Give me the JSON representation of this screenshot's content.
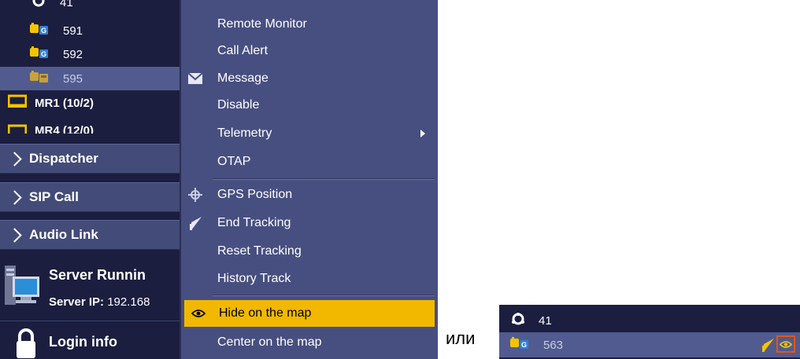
{
  "tree": {
    "items": [
      {
        "label": "41"
      },
      {
        "label": "591"
      },
      {
        "label": "592"
      },
      {
        "label": "595"
      }
    ],
    "groups": [
      {
        "label": "MR1 (10/2)"
      },
      {
        "label": "MR4 (12/0)"
      }
    ]
  },
  "sections": [
    {
      "label": "Dispatcher"
    },
    {
      "label": "SIP Call"
    },
    {
      "label": "Audio Link"
    }
  ],
  "server": {
    "title": "Server Runnin",
    "ip_label": "Server IP:",
    "ip_value": "192.168"
  },
  "login": {
    "title": "Login info"
  },
  "context_menu": {
    "items": [
      {
        "label": "Remote Monitor"
      },
      {
        "label": "Call Alert"
      },
      {
        "label": "Message",
        "icon": "envelope-icon"
      },
      {
        "label": "Disable"
      },
      {
        "label": "Telemetry",
        "has_submenu": true
      },
      {
        "label": "OTAP"
      },
      {
        "label": "GPS Position",
        "icon": "crosshair-icon"
      },
      {
        "label": "End Tracking",
        "icon": "flag-icon"
      },
      {
        "label": "Reset Tracking"
      },
      {
        "label": "History Track"
      },
      {
        "label": "Hide on the map",
        "icon": "eye-icon",
        "highlighted": true
      },
      {
        "label": "Center on the map"
      }
    ]
  },
  "separator_text": "или",
  "mini_panel": {
    "items": [
      {
        "label": "41"
      },
      {
        "label": "563"
      }
    ]
  },
  "colors": {
    "panel_bg": "#1b1e3f",
    "menu_bg": "#474f80",
    "highlight": "#f2b800",
    "selected_row": "#525b8f",
    "icon_yellow": "#f5c400",
    "icon_blue": "#2f7fd6"
  }
}
